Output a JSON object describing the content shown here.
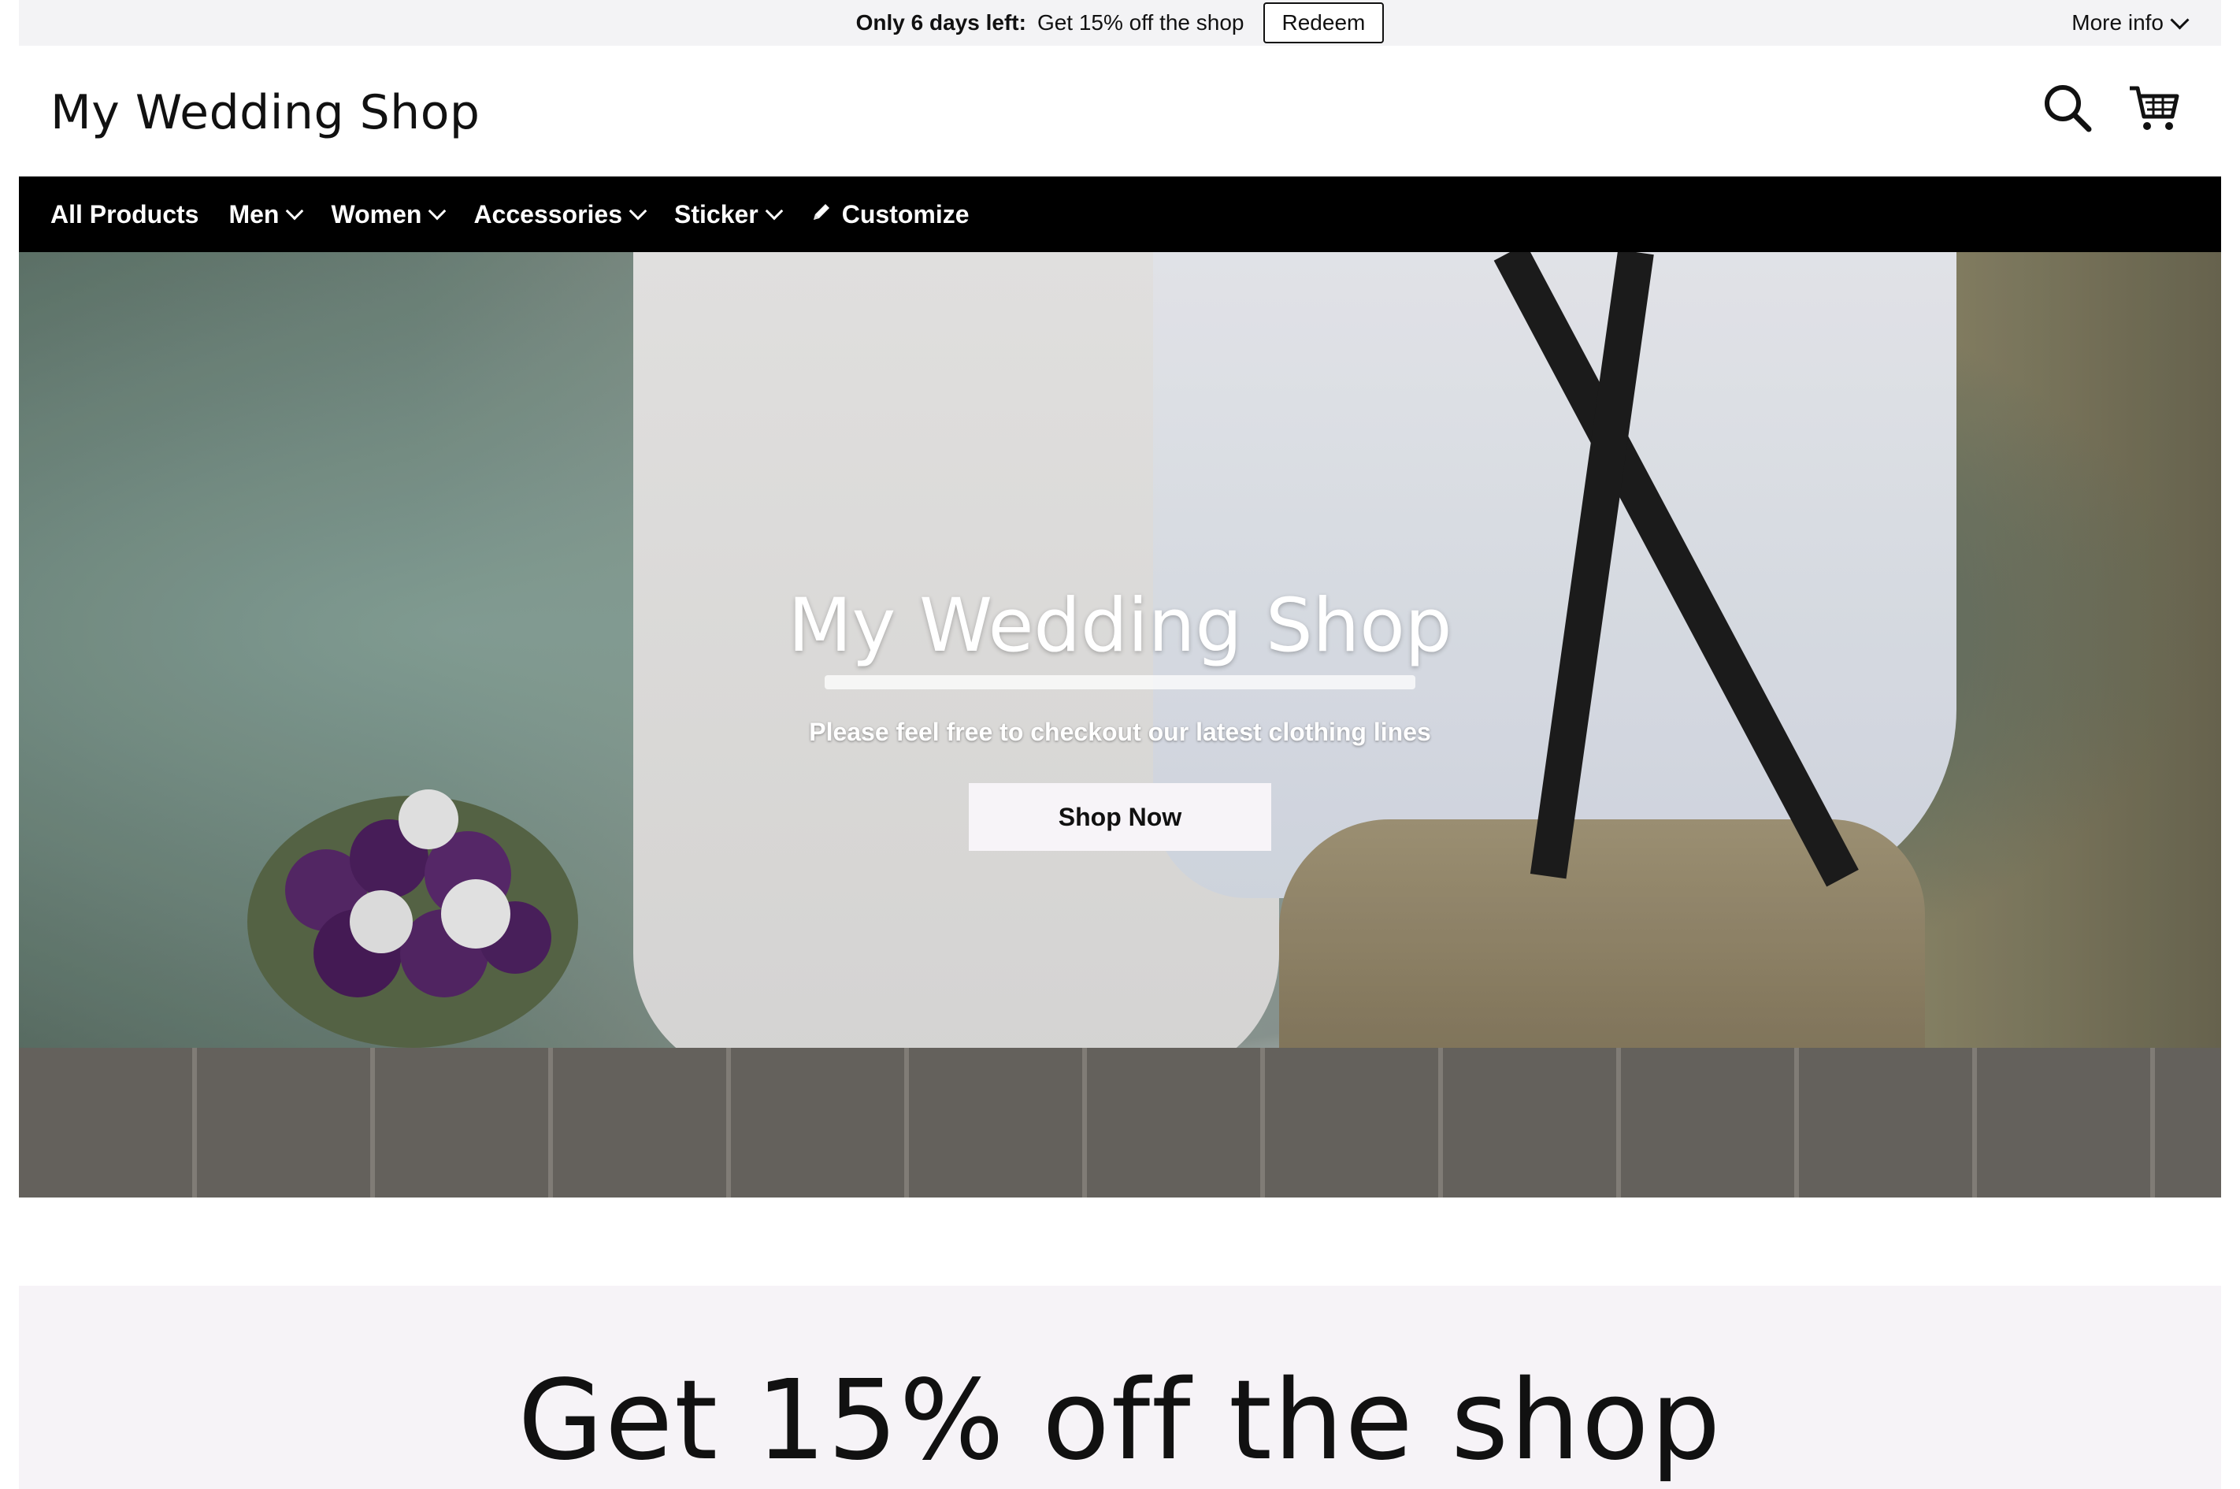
{
  "promo_bar": {
    "countdown": "Only 6 days left:",
    "offer": "Get 15% off the shop",
    "redeem_label": "Redeem",
    "more_info_label": "More info"
  },
  "header": {
    "logo": "My Wedding Shop",
    "icons": [
      "search-icon",
      "cart-icon"
    ]
  },
  "nav": {
    "items": [
      {
        "label": "All Products",
        "dropdown": false
      },
      {
        "label": "Men",
        "dropdown": true
      },
      {
        "label": "Women",
        "dropdown": true
      },
      {
        "label": "Accessories",
        "dropdown": true
      },
      {
        "label": "Sticker",
        "dropdown": true
      },
      {
        "label": "Customize",
        "icon": "pencil-icon"
      }
    ]
  },
  "hero": {
    "title": "My Wedding Shop",
    "subtitle": "Please feel free to checkout our latest clothing lines",
    "cta_label": "Shop Now"
  },
  "discount_section": {
    "title": "Get 15% off the shop"
  }
}
